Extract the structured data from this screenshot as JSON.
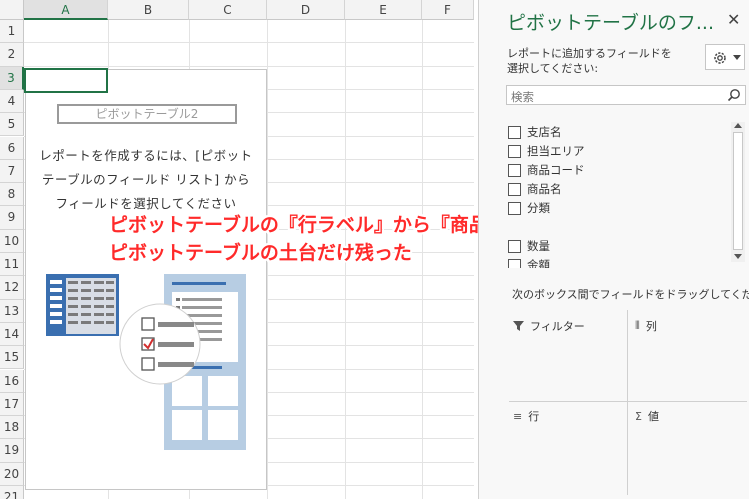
{
  "sheet": {
    "columns": [
      "A",
      "B",
      "C",
      "D",
      "E",
      "F"
    ],
    "rows": [
      "1",
      "2",
      "3",
      "4",
      "5",
      "6",
      "7",
      "8",
      "9",
      "10",
      "11",
      "12",
      "13",
      "14",
      "15",
      "16",
      "17",
      "18",
      "19",
      "20",
      "21"
    ]
  },
  "pivot": {
    "name": "ピボットテーブル2",
    "message_lines": [
      "レポートを作成するには、[ピボット",
      "テーブルのフィールド リスト] から",
      "フィールドを選択してください"
    ]
  },
  "overlay": {
    "line1": "ピボットテーブルの『行ラベル』から『商品名』が削除され",
    "line2": "ピボットテーブルの土台だけ残った",
    "color": "#ff2a2a"
  },
  "panel": {
    "title": "ピボットテーブルのフ...",
    "close": "✕",
    "description": "レポートに追加するフィールドを選択してください:",
    "search_placeholder": "検索",
    "fields": [
      "支店名",
      "担当エリア",
      "商品コード",
      "商品名",
      "分類",
      "数量",
      "金額"
    ],
    "drag_label": "次のボックス間でフィールドをドラッグしてください:",
    "areas": {
      "filter": "フィルター",
      "columns": "列",
      "rows": "行",
      "values": "値"
    },
    "accent": "#217346"
  }
}
